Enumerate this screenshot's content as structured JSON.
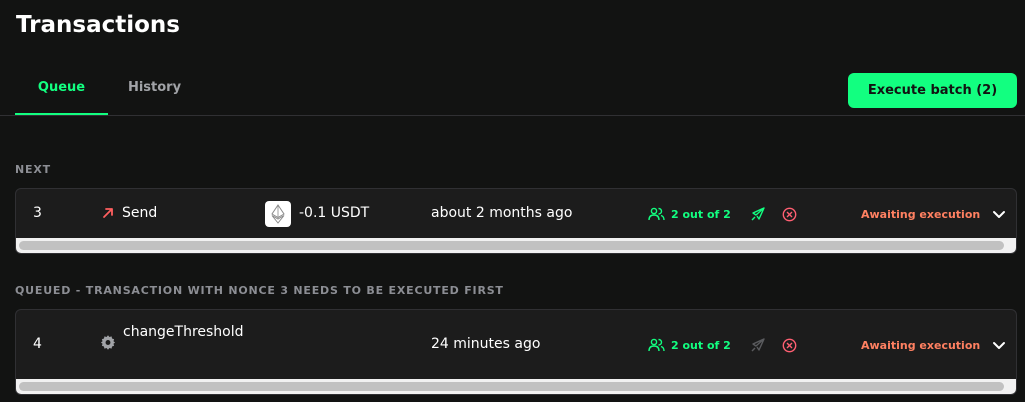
{
  "header": {
    "title": "Transactions"
  },
  "tabs": [
    {
      "label": "Queue",
      "active": true
    },
    {
      "label": "History",
      "active": false
    }
  ],
  "execute_batch_label": "Execute batch (2)",
  "sections": {
    "next_label": "NEXT",
    "queued_label": "QUEUED - TRANSACTION WITH NONCE 3 NEEDS TO BE EXECUTED FIRST"
  },
  "transactions": [
    {
      "nonce": "3",
      "type_icon": "arrow-up-right-icon",
      "type_label": "Send",
      "token_icon": "ethereum-token-icon",
      "amount": "-0.1 USDT",
      "date": "about 2 months ago",
      "confirmations": "2 out of 2",
      "status": "Awaiting execution"
    },
    {
      "nonce": "4",
      "type_icon": "gear-icon",
      "type_label": "changeThreshold",
      "date": "24 minutes ago",
      "confirmations": "2 out of 2",
      "status": "Awaiting execution"
    }
  ],
  "colors": {
    "background": "#121312",
    "card": "#1c1c1c",
    "accent": "#12ff80",
    "status": "#ff8061",
    "danger": "#ff5f72",
    "send_arrow": "#ff5f5f",
    "muted": "#8c8e94"
  }
}
